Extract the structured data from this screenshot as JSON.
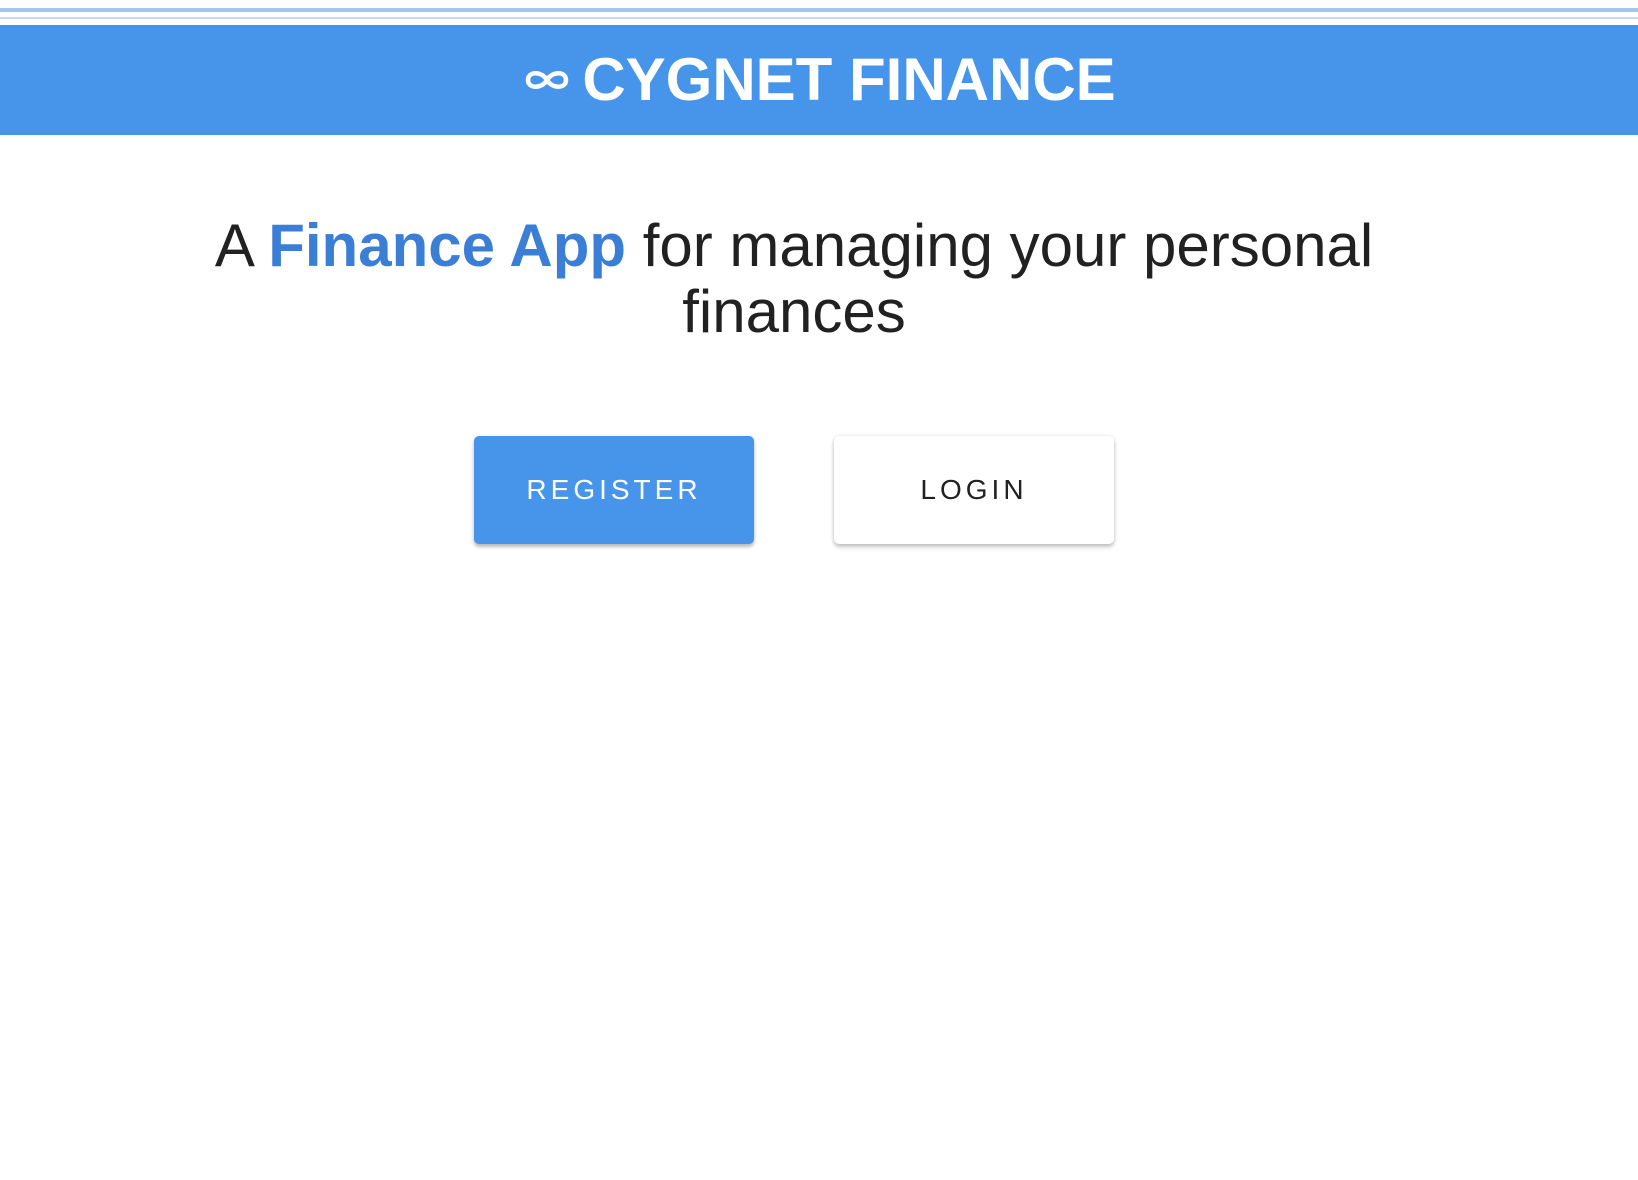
{
  "header": {
    "icon": "infinity-icon",
    "title": "CYGNET FINANCE",
    "background": "#4695eb"
  },
  "hero": {
    "prefix": "A",
    "accent": "Finance App",
    "suffix": "for managing your personal finances",
    "accent_color": "#3a7fd5"
  },
  "actions": {
    "register_label": "REGISTER",
    "login_label": "LOGIN"
  }
}
